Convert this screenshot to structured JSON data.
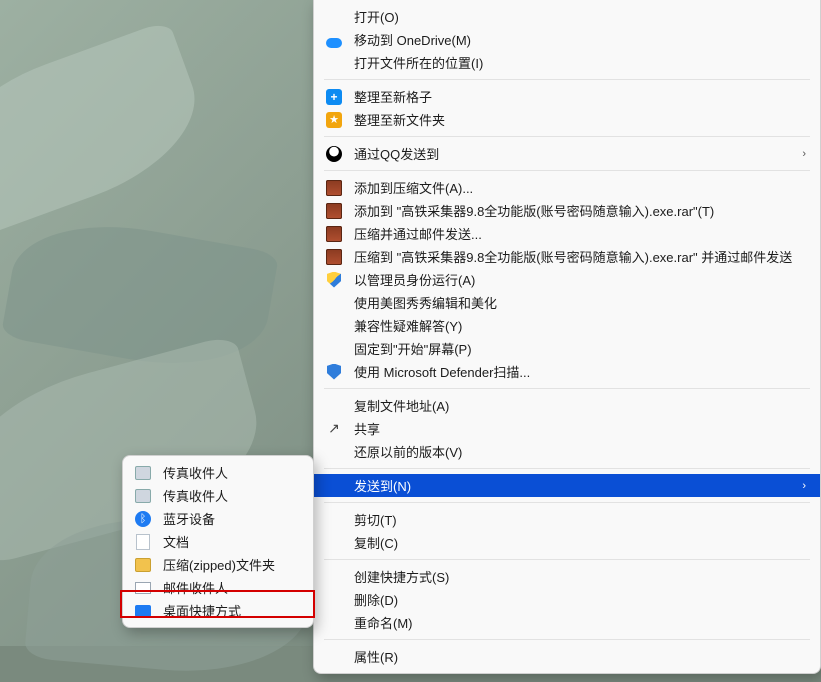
{
  "main_menu": {
    "groups": [
      [
        {
          "key": "open",
          "label": "打开(O)",
          "icon": null
        },
        {
          "key": "onedrive",
          "label": "移动到 OneDrive(M)",
          "icon": "cloud"
        },
        {
          "key": "openloc",
          "label": "打开文件所在的位置(I)",
          "icon": null
        }
      ],
      [
        {
          "key": "newgrid",
          "label": "整理至新格子",
          "icon": "plus"
        },
        {
          "key": "newfolder",
          "label": "整理至新文件夹",
          "icon": "star"
        }
      ],
      [
        {
          "key": "qqsend",
          "label": "通过QQ发送到",
          "icon": "penguin",
          "submenu": true
        }
      ],
      [
        {
          "key": "addrar",
          "label": "添加到压缩文件(A)...",
          "icon": "rar"
        },
        {
          "key": "addrarname",
          "label": "添加到 \"高铁采集器9.8全功能版(账号密码随意输入).exe.rar\"(T)",
          "icon": "rar"
        },
        {
          "key": "rarmail",
          "label": "压缩并通过邮件发送...",
          "icon": "rar"
        },
        {
          "key": "rarmailname",
          "label": "压缩到 \"高铁采集器9.8全功能版(账号密码随意输入).exe.rar\" 并通过邮件发送",
          "icon": "rar"
        },
        {
          "key": "runas",
          "label": "以管理员身份运行(A)",
          "icon": "shield"
        },
        {
          "key": "meitu",
          "label": "使用美图秀秀编辑和美化",
          "icon": null
        },
        {
          "key": "compat",
          "label": "兼容性疑难解答(Y)",
          "icon": null
        },
        {
          "key": "pin",
          "label": "固定到\"开始\"屏幕(P)",
          "icon": null
        },
        {
          "key": "defender",
          "label": "使用 Microsoft Defender扫描...",
          "icon": "shieldblue"
        }
      ],
      [
        {
          "key": "copypath",
          "label": "复制文件地址(A)",
          "icon": null
        },
        {
          "key": "share",
          "label": "共享",
          "icon": "share"
        },
        {
          "key": "restore",
          "label": "还原以前的版本(V)",
          "icon": null
        }
      ],
      [
        {
          "key": "sendto",
          "label": "发送到(N)",
          "icon": null,
          "submenu": true,
          "highlight": true
        }
      ],
      [
        {
          "key": "cut",
          "label": "剪切(T)",
          "icon": null
        },
        {
          "key": "copy",
          "label": "复制(C)",
          "icon": null
        }
      ],
      [
        {
          "key": "shortcut",
          "label": "创建快捷方式(S)",
          "icon": null
        },
        {
          "key": "delete",
          "label": "删除(D)",
          "icon": null
        },
        {
          "key": "rename",
          "label": "重命名(M)",
          "icon": null
        }
      ],
      [
        {
          "key": "props",
          "label": "属性(R)",
          "icon": null
        }
      ]
    ]
  },
  "sub_menu": {
    "items": [
      {
        "key": "fax1",
        "label": "传真收件人",
        "icon": "fax"
      },
      {
        "key": "fax2",
        "label": "传真收件人",
        "icon": "fax"
      },
      {
        "key": "bt",
        "label": "蓝牙设备",
        "icon": "bt"
      },
      {
        "key": "docs",
        "label": "文档",
        "icon": "doc"
      },
      {
        "key": "zip",
        "label": "压缩(zipped)文件夹",
        "icon": "zip"
      },
      {
        "key": "mail",
        "label": "邮件收件人",
        "icon": "mail"
      },
      {
        "key": "desktop",
        "label": "桌面快捷方式",
        "icon": "desk"
      }
    ]
  }
}
